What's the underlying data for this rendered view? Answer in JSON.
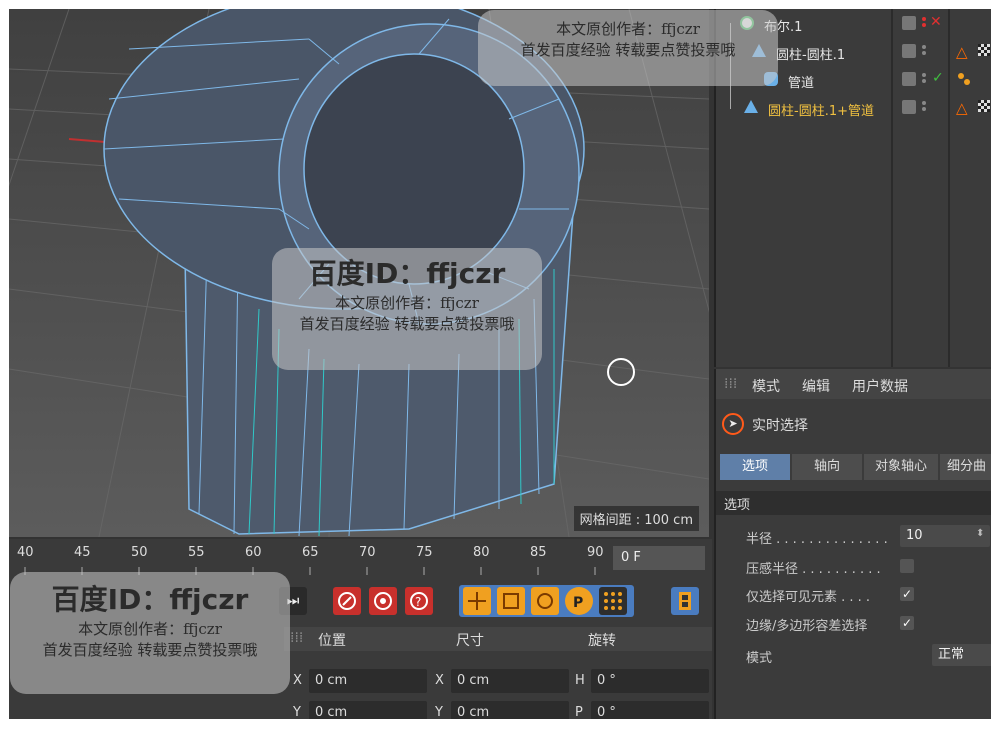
{
  "viewport": {
    "grid_spacing": "网格间距 : 100 cm"
  },
  "object_manager": {
    "objects": [
      {
        "name": "布尔.1",
        "color": "#e6e6e6",
        "status": "✕",
        "status_color": "#e03030"
      },
      {
        "name": "圆柱-圆柱.1",
        "color": "#e6e6e6"
      },
      {
        "name": "管道",
        "color": "#e6e6e6",
        "status": "✓",
        "status_color": "#40c040"
      },
      {
        "name": "圆柱-圆柱.1+管道",
        "color": "#f0c040"
      }
    ]
  },
  "attribute_manager": {
    "menu": [
      "模式",
      "编辑",
      "用户数据"
    ],
    "tool_title": "实时选择",
    "tabs": [
      "选项",
      "轴向",
      "对象轴心",
      "细分曲"
    ],
    "active_tab": "选项",
    "section_title": "选项",
    "fields": {
      "radius_label": "半径 . . . . . . . . . . . . . .",
      "radius_value": "10",
      "pressure_label": "压感半径 . . . . . . . . . .",
      "visible_only_label": "仅选择可见元素 . . . .",
      "visible_only_check": "✓",
      "polygon_label": "边缘/多边形容差选择",
      "polygon_check": "✓",
      "mode_label": "模式",
      "mode_value": "正常"
    }
  },
  "timeline": {
    "ticks": [
      "40",
      "45",
      "50",
      "55",
      "60",
      "65",
      "70",
      "75",
      "80",
      "85",
      "90"
    ],
    "current_frame": "0 F"
  },
  "coordinates": {
    "headers": [
      "位置",
      "尺寸",
      "旋转"
    ],
    "rows": [
      {
        "pos_axis": "X",
        "pos": "0 cm",
        "size_axis": "X",
        "size": "0 cm",
        "rot_axis": "H",
        "rot": "0 °"
      },
      {
        "pos_axis": "Y",
        "pos": "0 cm",
        "size_axis": "Y",
        "size": "0 cm",
        "rot_axis": "P",
        "rot": "0 °"
      }
    ]
  },
  "watermarks": {
    "id_text": "百度ID：ffjczr",
    "author": "本文原创作者：ffjczr",
    "slogan": "首发百度经验  转载要点赞投票哦"
  },
  "colors": {
    "accent_blue": "#5f7fa8",
    "selection_orange": "#ff6a00",
    "record_red": "#c8302c"
  }
}
